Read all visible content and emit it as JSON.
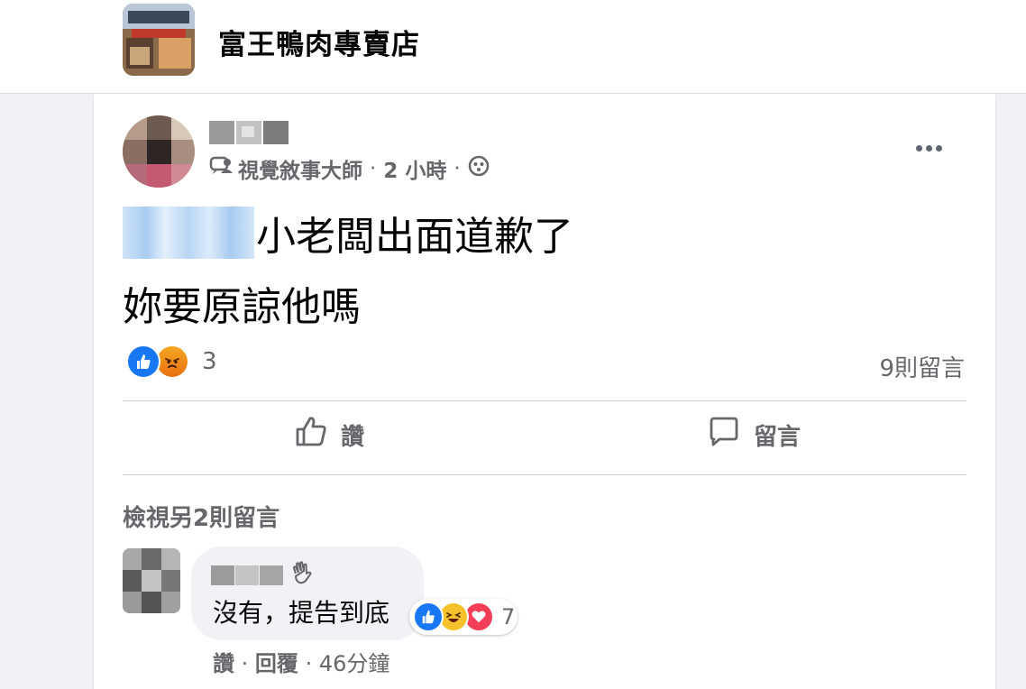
{
  "page": {
    "name": "富王鴨肉專賣店"
  },
  "post": {
    "group_name": "視覺敘事大師",
    "time": "2 小時",
    "sep": "·",
    "line1": "小老闆出面道歉了",
    "line2": "妳要原諒他嗎",
    "reaction_count": "3",
    "comment_count": "9則留言"
  },
  "actions": {
    "like_label": "讚",
    "comment_label": "留言"
  },
  "comments": {
    "view_more": "檢視另2則留言",
    "first": {
      "text": "沒有，提告到底",
      "reaction_count": "7",
      "like_action": "讚",
      "reply_action": "回覆",
      "sep": "·",
      "time": "46分鐘"
    }
  },
  "colors": {
    "accent": "#1877f2",
    "muted_text": "#65676b",
    "love": "#f33e58"
  },
  "icons": [
    "group-icon",
    "globe-icon",
    "more-icon",
    "thumbs-up-icon",
    "comment-bubble-icon",
    "wave-icon"
  ]
}
